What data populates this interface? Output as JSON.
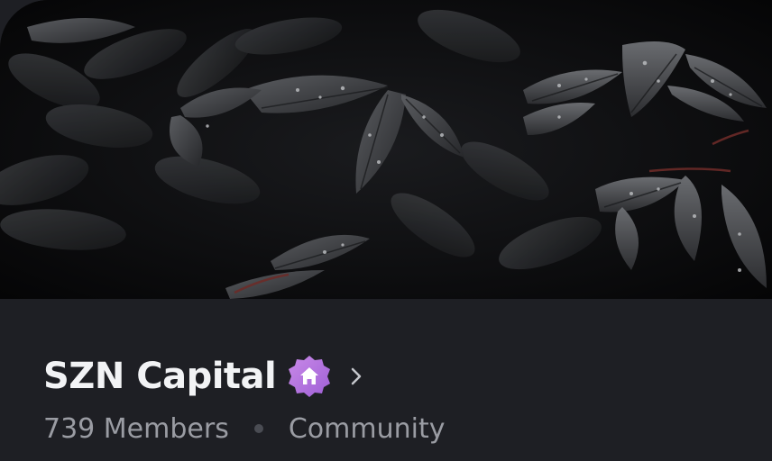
{
  "server": {
    "name": "SZN Capital",
    "members": "739 Members",
    "type": "Community",
    "badge_icon": "community-server-badge-icon",
    "badge_color": "#b473e0",
    "chevron_icon": "chevron-right-icon"
  },
  "banner": {
    "image_description": "dark-leaves-with-raindrops"
  },
  "colors": {
    "background": "#1e1f24",
    "title": "#f2f3f5",
    "meta": "#9a9ca3"
  }
}
